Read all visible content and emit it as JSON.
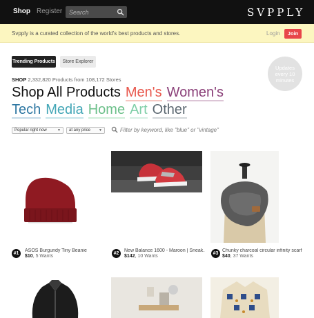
{
  "nav": {
    "shop_label": "Shop",
    "register_label": "Register",
    "search_placeholder": "Search",
    "logo_text": "SVPPLY"
  },
  "notice": {
    "text": "Svpply is a curated collection of the world's best products and stores.",
    "login_label": "Login",
    "join_label": "Join"
  },
  "tabs": [
    {
      "label": "Trending Products",
      "active": true
    },
    {
      "label": "Store Explorer",
      "active": false
    }
  ],
  "badge": {
    "line1": "Updates",
    "line2": "every 10",
    "line3": "minutes"
  },
  "counts": {
    "shop_label": "SHOP",
    "products": "2,332,820",
    "products_from": "Products from",
    "stores": "108,172",
    "stores_label": "Stores"
  },
  "categories": {
    "shop_all": "Shop All Products",
    "mens": "Men's",
    "womens": "Women's",
    "tech": "Tech",
    "media": "Media",
    "home": "Home",
    "art": "Art",
    "other": "Other"
  },
  "filters": {
    "sort_value": "Popular right now",
    "price_value": "at any price",
    "keyword_placeholder": "Filter by keyword, like \"blue\" or \"vintage\""
  },
  "products": [
    {
      "rank": "#1",
      "title": "ASOS Burgundy Tiny Beanie",
      "price": "$10",
      "wants": ", 5 Wants"
    },
    {
      "rank": "#2",
      "title": "New Balance 1600 - Maroon | Sneak...",
      "price": "$142",
      "wants": ", 10 Wants"
    },
    {
      "rank": "#3",
      "title": "Chunky charcoal circular infinity scarf",
      "price": "$40",
      "wants": ", 37 Wants"
    }
  ],
  "colors": {
    "topbar": "#111111",
    "notice_bg": "#fcf6c0",
    "join": "#e8454a",
    "mens": "#e8564b",
    "womens": "#8a3f78",
    "tech": "#2f78a3",
    "media": "#42a6b6",
    "home": "#6cc08a",
    "art": "#80cfa8",
    "other": "#5e6a73"
  }
}
